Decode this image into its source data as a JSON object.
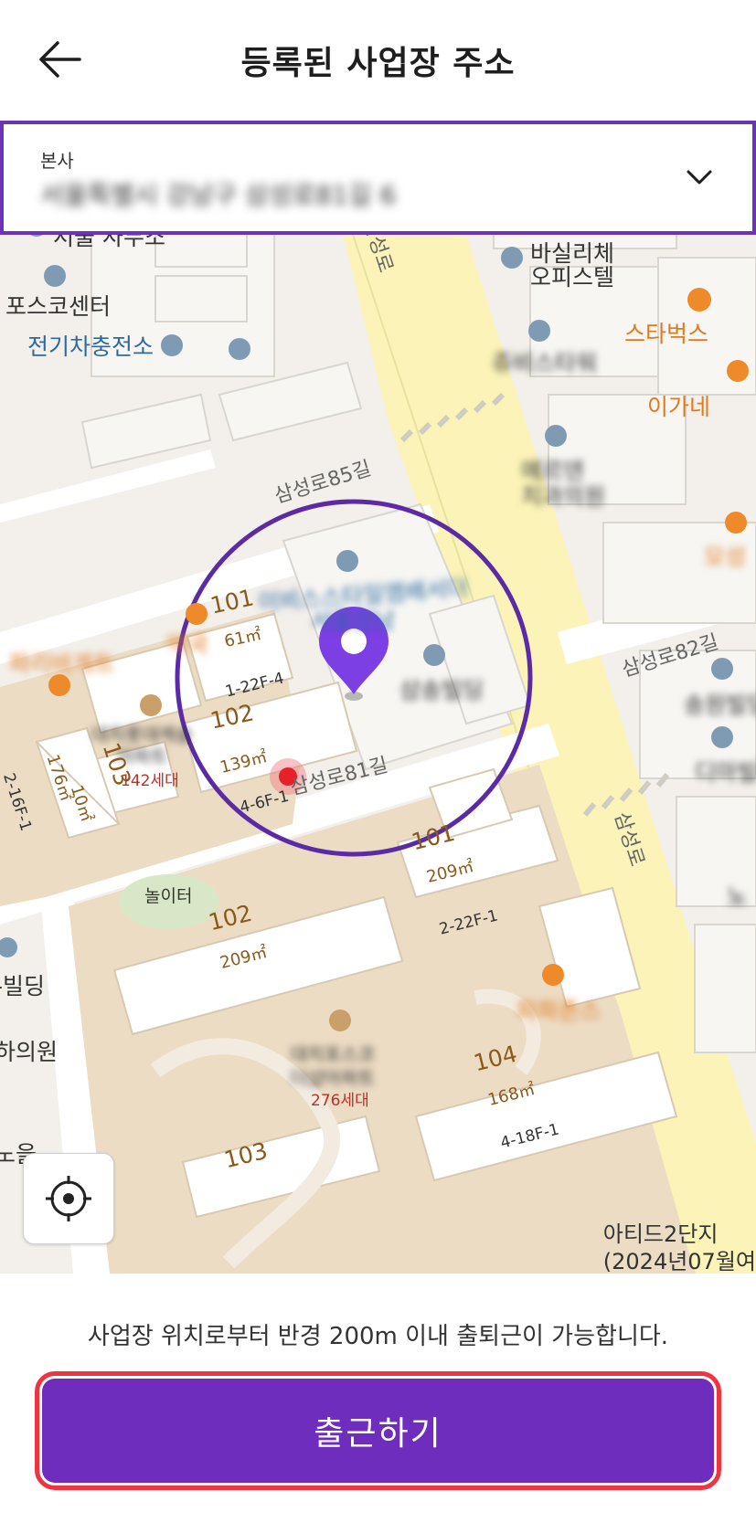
{
  "header": {
    "title": "등록된 사업장 주소",
    "back_icon": "arrow-left-icon"
  },
  "address_selector": {
    "label": "본사",
    "value": "서울특별시 강남구 삼성로81길 6",
    "chevron_icon": "chevron-down-icon"
  },
  "map": {
    "labels": {
      "seoul_office": "서울 사무소",
      "posco_center": "포스코센터",
      "ev_charging": "전기차충전소",
      "basilicche_1": "바실리체",
      "basilicche_2": "오피스텔",
      "starbucks": "스타벅스",
      "building_blur_1": "쥬비스타워",
      "igane": "이가네",
      "dental_1": "에르덴",
      "dental_2": "치과의원",
      "road_85": "삼성로85길",
      "hotel_1": "이비스스타일엠배서더",
      "hotel_2": "서울강남",
      "samsung_bldg": "삼송빌딩",
      "road_82": "삼성로82길",
      "samsungro_v1": "삼성로",
      "samsungro_v2": "삼성로",
      "bldg_101_top": "101",
      "area_61": "61㎡",
      "paris": "파리바게트",
      "pharmacy": "약국",
      "apt_daechi_1": "대치롯데캐슬",
      "apt_daechi_2": "아파트",
      "households_142": "142세대",
      "bldg_102_top": "102",
      "floor_1_22": "1-22F-4",
      "bldg_103_left": "103",
      "area_139": "139㎡",
      "area_176": "176㎡",
      "area_10": "10㎡",
      "floor_2_16": "2-16F-1",
      "floor_4_6": "4-6F-1",
      "road_81": "삼성로81길",
      "bldg_101": "101",
      "area_209_a": "209㎡",
      "floor_2_22": "2-22F-1",
      "playground": "놀이터",
      "bldg_102": "102",
      "area_209_b": "209㎡",
      "bldg_left": "-빌딩",
      "clinic_left": "하의원",
      "papa_johns": "파파존스",
      "daechi_apt_1": "대치포스코",
      "daechi_apt_2": "더샵아파트",
      "households_276": "276세대",
      "bldg_104": "104",
      "area_168": "168㎡",
      "floor_4_18": "4-18F-1",
      "bldg_103": "103",
      "noeul": "노을",
      "right_blur_1": "송원빌딩",
      "right_blur_2": "디마빌딩",
      "right_blur_3": "모성",
      "right_blur_4": "노"
    },
    "credit_line1": "아티드2단지",
    "credit_line2": "(2024년07월여",
    "radius_color": "#5b2ba6",
    "pin_color": "#7b3fe4",
    "current_location_color": "#e8202a",
    "locate_icon": "crosshair-icon"
  },
  "bottom": {
    "info": "사업장 위치로부터 반경 200m 이내 출퇴근이 가능합니다.",
    "checkin_label": "출근하기",
    "button_color": "#6f2dbd",
    "highlight_color": "#ef3340"
  }
}
